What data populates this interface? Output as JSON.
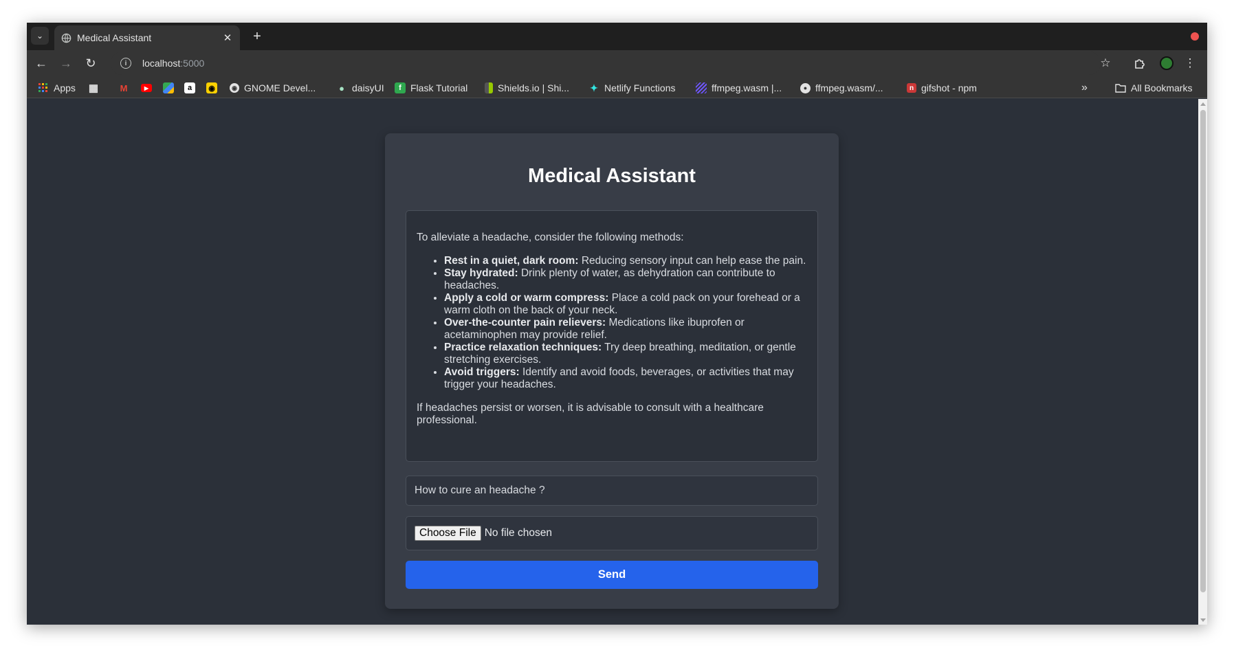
{
  "browser": {
    "tab_title": "Medical Assistant",
    "url_host": "localhost",
    "url_port": ":5000",
    "record_color": "#ef5350",
    "bookmarks": [
      {
        "label": "Apps",
        "icon": "apps-grid-icon"
      },
      {
        "label": "",
        "icon": "grid-icon"
      },
      {
        "label": "",
        "icon": "gmail-icon"
      },
      {
        "label": "",
        "icon": "youtube-icon"
      },
      {
        "label": "",
        "icon": "maps-icon"
      },
      {
        "label": "",
        "icon": "amazon-icon"
      },
      {
        "label": "",
        "icon": "app-icon"
      },
      {
        "label": "GNOME Devel...",
        "icon": "globe-icon"
      },
      {
        "label": "daisyUI",
        "icon": "daisyui-icon"
      },
      {
        "label": "Flask Tutorial",
        "icon": "flask-icon"
      },
      {
        "label": "Shields.io | Shi...",
        "icon": "shields-icon"
      },
      {
        "label": "Netlify Functions",
        "icon": "netlify-icon"
      },
      {
        "label": "ffmpeg.wasm |...",
        "icon": "ffmpeg-icon"
      },
      {
        "label": "ffmpeg.wasm/...",
        "icon": "github-icon"
      },
      {
        "label": "gifshot - npm",
        "icon": "npm-icon"
      }
    ],
    "overflow_label": "»",
    "all_bookmarks_label": "All Bookmarks"
  },
  "app": {
    "title": "Medical Assistant",
    "response": {
      "intro": "To alleviate a headache, consider the following methods:",
      "items": [
        {
          "bold": "Rest in a quiet, dark room:",
          "text": " Reducing sensory input can help ease the pain."
        },
        {
          "bold": "Stay hydrated:",
          "text": " Drink plenty of water, as dehydration can contribute to headaches."
        },
        {
          "bold": "Apply a cold or warm compress:",
          "text": " Place a cold pack on your forehead or a warm cloth on the back of your neck."
        },
        {
          "bold": "Over-the-counter pain relievers:",
          "text": " Medications like ibuprofen or acetaminophen may provide relief."
        },
        {
          "bold": "Practice relaxation techniques:",
          "text": " Try deep breathing, meditation, or gentle stretching exercises."
        },
        {
          "bold": "Avoid triggers:",
          "text": " Identify and avoid foods, beverages, or activities that may trigger your headaches."
        }
      ],
      "outro": "If headaches persist or worsen, it is advisable to consult with a healthcare professional."
    },
    "question_value": "How to cure an headache ?",
    "file_button_label": "Choose File",
    "file_status": "No file chosen",
    "send_label": "Send",
    "accent_color": "#2563eb"
  }
}
